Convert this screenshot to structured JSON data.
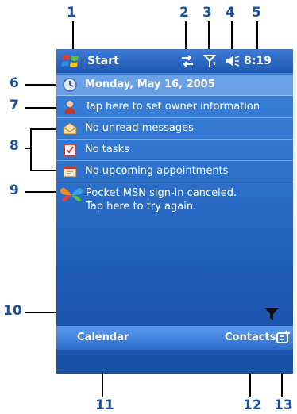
{
  "callouts": [
    "1",
    "2",
    "3",
    "4",
    "5",
    "6",
    "7",
    "8",
    "9",
    "10",
    "11",
    "12",
    "13"
  ],
  "titlebar": {
    "start_label": "Start",
    "time": "8:19"
  },
  "today": {
    "date": "Monday, May 16, 2005",
    "owner": "Tap here to set owner information",
    "messages": "No unread messages",
    "tasks": "No tasks",
    "appointments": "No upcoming appointments",
    "msn_line1": "Pocket MSN sign-in canceled.",
    "msn_line2": "Tap here to try again."
  },
  "softkeys": {
    "left": "Calendar",
    "right": "Contacts"
  },
  "colors": {
    "callout": "#1a4fa0",
    "screen_blue": "#2f74cf"
  },
  "icons": {
    "start": "windows-flag-icon",
    "connectivity": "connectivity-arrows-icon",
    "signal": "signal-antenna-icon",
    "volume": "speaker-icon",
    "date": "clock-icon",
    "owner": "person-icon",
    "messages": "envelope-icon",
    "tasks": "checkbox-icon",
    "appointments": "calendar-icon",
    "msn": "msn-butterfly-icon",
    "filter": "funnel-icon",
    "sip": "keyboard-input-icon"
  }
}
